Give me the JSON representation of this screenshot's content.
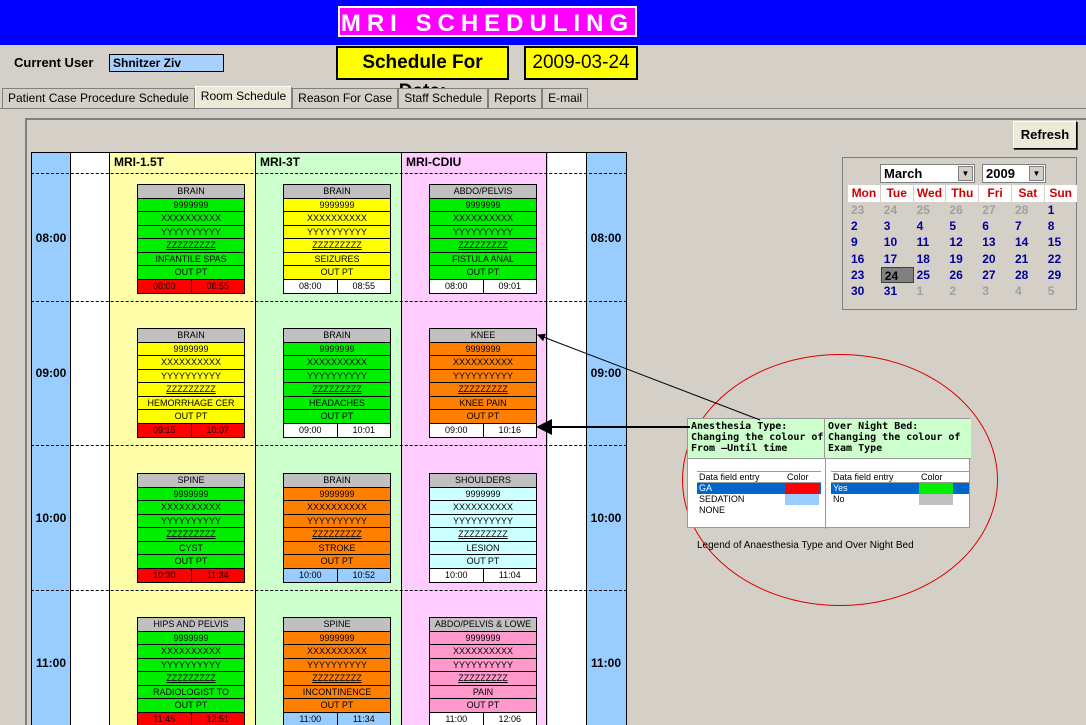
{
  "header": {
    "app_title": "MRI SCHEDULING",
    "current_user_label": "Current User",
    "current_user": "Shnitzer Ziv",
    "schedule_for_label": "Schedule For Date:",
    "schedule_date": "2009-03-24"
  },
  "tabs": [
    "Patient Case Procedure  Schedule",
    "Room Schedule",
    "Reason For Case",
    "Staff Schedule",
    "Reports",
    "E-mail"
  ],
  "refresh_label": "Refresh",
  "rooms": [
    "MRI-1.5T",
    "MRI-3T",
    "MRI-CDIU"
  ],
  "hours": [
    "08:00",
    "09:00",
    "10:00",
    "11:00"
  ],
  "appointments": [
    [
      {
        "exam": "BRAIN",
        "lines": [
          "9999999",
          "XXXXXXXXXX",
          "YYYYYYYYYY",
          "ZZZZZZZZZ"
        ],
        "reason": "INFANTILE SPAS",
        "status": "OUT PT",
        "from": "08:00",
        "until": "08:55"
      },
      {
        "exam": "BRAIN",
        "lines": [
          "9999999",
          "XXXXXXXXXX",
          "YYYYYYYYYY",
          "ZZZZZZZZZ"
        ],
        "reason": "SEIZURES",
        "status": "OUT PT",
        "from": "08:00",
        "until": "08:55"
      },
      {
        "exam": "ABDO/PELVIS",
        "lines": [
          "9999999",
          "XXXXXXXXXX",
          "YYYYYYYYYY",
          "ZZZZZZZZZ"
        ],
        "reason": "FISTULA ANAL",
        "status": "OUT PT",
        "from": "08:00",
        "until": "09:01"
      }
    ],
    [
      {
        "exam": "BRAIN",
        "lines": [
          "9999999",
          "XXXXXXXXXX",
          "YYYYYYYYYY",
          "ZZZZZZZZZ"
        ],
        "reason": "HEMORRHAGE CER",
        "status": "OUT PT",
        "from": "09:15",
        "until": "10:07"
      },
      {
        "exam": "BRAIN",
        "lines": [
          "9999999",
          "XXXXXXXXXX",
          "YYYYYYYYYY",
          "ZZZZZZZZZ"
        ],
        "reason": "HEADACHES",
        "status": "OUT PT",
        "from": "09:00",
        "until": "10:01"
      },
      {
        "exam": "KNEE",
        "lines": [
          "9999999",
          "XXXXXXXXXX",
          "YYYYYYYYYY",
          "ZZZZZZZZZ"
        ],
        "reason": "KNEE PAIN",
        "status": "OUT PT",
        "from": "09:00",
        "until": "10:16"
      }
    ],
    [
      {
        "exam": "SPINE",
        "lines": [
          "9999999",
          "XXXXXXXXXX",
          "YYYYYYYYYY",
          "ZZZZZZZZZ"
        ],
        "reason": "CYST",
        "status": "OUT PT",
        "from": "10:30",
        "until": "11:34"
      },
      {
        "exam": "BRAIN",
        "lines": [
          "9999999",
          "XXXXXXXXXX",
          "YYYYYYYYYY",
          "ZZZZZZZZZ"
        ],
        "reason": "STROKE",
        "status": "OUT PT",
        "from": "10:00",
        "until": "10:52"
      },
      {
        "exam": "SHOULDERS",
        "lines": [
          "9999999",
          "XXXXXXXXXX",
          "YYYYYYYYYY",
          "ZZZZZZZZZ"
        ],
        "reason": "LESION",
        "status": "OUT PT",
        "from": "10:00",
        "until": "11:04"
      }
    ],
    [
      {
        "exam": "HIPS AND PELVIS",
        "lines": [
          "9999999",
          "XXXXXXXXXX",
          "YYYYYYYYYY",
          "ZZZZZZZZZ"
        ],
        "reason": "RADIOLOGIST TO",
        "status": "OUT PT",
        "from": "11:45",
        "until": "12:51"
      },
      {
        "exam": "SPINE",
        "lines": [
          "9999999",
          "XXXXXXXXXX",
          "YYYYYYYYYY",
          "ZZZZZZZZZ"
        ],
        "reason": "INCONTINENCE",
        "status": "OUT PT",
        "from": "11:00",
        "until": "11:34"
      },
      {
        "exam": "ABDO/PELVIS & LOWE",
        "lines": [
          "9999999",
          "XXXXXXXXXX",
          "YYYYYYYYYY",
          "ZZZZZZZZZ"
        ],
        "reason": "PAIN",
        "status": "OUT PT",
        "from": "11:00",
        "until": "12:06"
      }
    ]
  ],
  "card_colors": [
    [
      {
        "body": "#00ee00",
        "time": "#ff0000"
      },
      {
        "body": "#ffff00",
        "time": "#ffffff"
      },
      {
        "body": "#00ee00",
        "time": "#ffffff"
      }
    ],
    [
      {
        "body": "#ffff00",
        "time": "#ff0000"
      },
      {
        "body": "#00ee00",
        "time": "#ffffff"
      },
      {
        "body": "#ff8000",
        "time": "#ffffff"
      }
    ],
    [
      {
        "body": "#00ee00",
        "time": "#ff0000"
      },
      {
        "body": "#ff8000",
        "time": "#99ccff"
      },
      {
        "body": "#ccffff",
        "time": "#ffffff"
      }
    ],
    [
      {
        "body": "#00ee00",
        "time": "#ff0000"
      },
      {
        "body": "#ff8000",
        "time": "#99ccff"
      },
      {
        "body": "#ff99cc",
        "time": "#ffffff"
      }
    ]
  ],
  "calendar": {
    "month": "March",
    "year": "2009",
    "weekdays": [
      "Mon",
      "Tue",
      "Wed",
      "Thu",
      "Fri",
      "Sat",
      "Sun"
    ],
    "days": [
      {
        "d": "23",
        "dim": true
      },
      {
        "d": "24",
        "dim": true
      },
      {
        "d": "25",
        "dim": true
      },
      {
        "d": "26",
        "dim": true
      },
      {
        "d": "27",
        "dim": true
      },
      {
        "d": "28",
        "dim": true
      },
      {
        "d": "1"
      },
      {
        "d": "2"
      },
      {
        "d": "3"
      },
      {
        "d": "4"
      },
      {
        "d": "5"
      },
      {
        "d": "6"
      },
      {
        "d": "7"
      },
      {
        "d": "8"
      },
      {
        "d": "9"
      },
      {
        "d": "10"
      },
      {
        "d": "11"
      },
      {
        "d": "12"
      },
      {
        "d": "13"
      },
      {
        "d": "14"
      },
      {
        "d": "15"
      },
      {
        "d": "16"
      },
      {
        "d": "17"
      },
      {
        "d": "18"
      },
      {
        "d": "19"
      },
      {
        "d": "20"
      },
      {
        "d": "21"
      },
      {
        "d": "22"
      },
      {
        "d": "23"
      },
      {
        "d": "24",
        "today": true
      },
      {
        "d": "25"
      },
      {
        "d": "26"
      },
      {
        "d": "27"
      },
      {
        "d": "28"
      },
      {
        "d": "29"
      },
      {
        "d": "30"
      },
      {
        "d": "31"
      },
      {
        "d": "1",
        "dim": true
      },
      {
        "d": "2",
        "dim": true
      },
      {
        "d": "3",
        "dim": true
      },
      {
        "d": "4",
        "dim": true
      },
      {
        "d": "5",
        "dim": true
      }
    ]
  },
  "legend": {
    "anesthesia_title": "Anesthesia Type:\nChanging the colour of\nFrom –Until time",
    "overnight_title": "Over Night Bed:\nChanging the colour of\nExam Type",
    "col_entry": "Data field entry",
    "col_color": "Color",
    "anesthesia_rows": [
      {
        "label": "GA",
        "color": "#ff0000"
      },
      {
        "label": "SEDATION",
        "color": "#99ccff"
      },
      {
        "label": "NONE",
        "color": "#ffffff"
      }
    ],
    "overnight_rows": [
      {
        "label": "Yes",
        "color": "#00ee00"
      },
      {
        "label": "No",
        "color": "#c0c0c0"
      }
    ],
    "caption": "Legend of Anaesthesia Type and Over Night Bed"
  }
}
